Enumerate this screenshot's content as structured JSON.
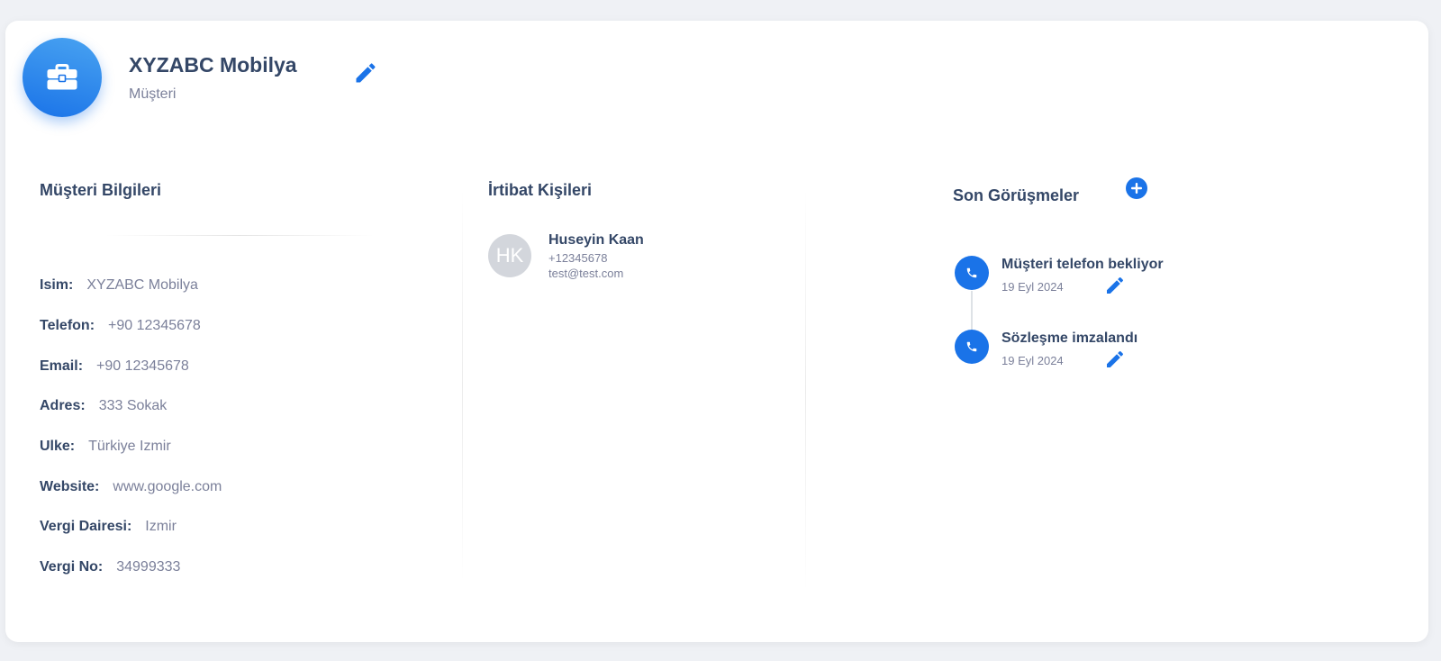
{
  "colors": {
    "primary": "#1a73e8",
    "heading": "#344767",
    "muted": "#7b809a",
    "background": "#eff1f5"
  },
  "header": {
    "company_name": "XYZABC Mobilya",
    "company_type": "Müşteri",
    "icon": "briefcase-icon",
    "edit_icon": "pencil-icon"
  },
  "customer_info": {
    "title": "Müşteri Bilgileri",
    "fields": [
      {
        "label": "Isim:",
        "value": "XYZABC Mobilya"
      },
      {
        "label": "Telefon:",
        "value": "+90 12345678"
      },
      {
        "label": "Email:",
        "value": "+90 12345678"
      },
      {
        "label": "Adres:",
        "value": "333 Sokak"
      },
      {
        "label": "Ulke:",
        "value": "Türkiye Izmir"
      },
      {
        "label": "Website:",
        "value": "www.google.com"
      },
      {
        "label": "Vergi Dairesi:",
        "value": "Izmir"
      },
      {
        "label": "Vergi No:",
        "value": "34999333"
      }
    ]
  },
  "contacts": {
    "title": "İrtibat Kişileri",
    "items": [
      {
        "initials": "HK",
        "name": "Huseyin Kaan",
        "phone": "+12345678",
        "email": "test@test.com"
      }
    ]
  },
  "meetings": {
    "title": "Son Görüşmeler",
    "add_icon": "plus-circle-icon",
    "items": [
      {
        "title": "Müşteri telefon bekliyor",
        "date": "19 Eyl 2024",
        "icon": "phone-icon"
      },
      {
        "title": "Sözleşme imzalandı",
        "date": "19 Eyl 2024",
        "icon": "phone-icon"
      }
    ]
  }
}
